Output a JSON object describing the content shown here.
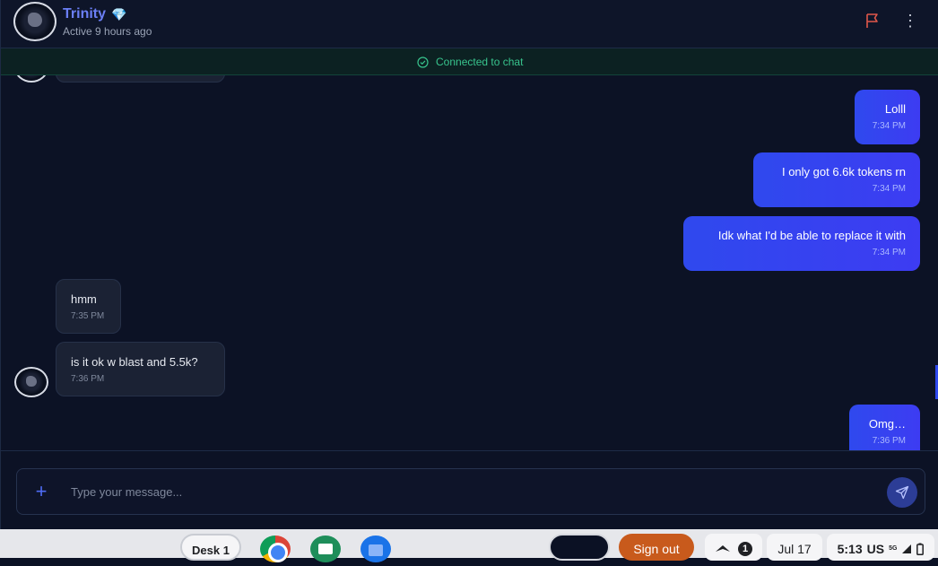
{
  "header": {
    "name": "Trinity",
    "status": "Active 9 hours ago"
  },
  "banner": {
    "text": "Connected to chat"
  },
  "messages": [
    {
      "side": "out",
      "text": "Lolll",
      "time": "7:34 PM"
    },
    {
      "side": "out",
      "text": "I only got 6.6k tokens rn",
      "time": "7:34 PM"
    },
    {
      "side": "out",
      "text": "Idk what I'd be able to replace it with",
      "time": "7:34 PM"
    },
    {
      "side": "in",
      "text": "hmm",
      "time": "7:35 PM"
    },
    {
      "side": "in",
      "text": "is it ok w blast and 5.5k?",
      "time": "7:36 PM"
    },
    {
      "side": "out",
      "text": "Omg…",
      "time": "7:36 PM"
    }
  ],
  "composer": {
    "placeholder": "Type your message..."
  },
  "shelf": {
    "desk_label": "Desk 1",
    "sign_out": "Sign out",
    "notification_count": "1",
    "date": "Jul 17",
    "time": "5:13",
    "locale": "US",
    "network": "5G"
  },
  "colors": {
    "accent": "#3d3cf2",
    "connected": "#38c48d",
    "flag": "#e0574a"
  }
}
